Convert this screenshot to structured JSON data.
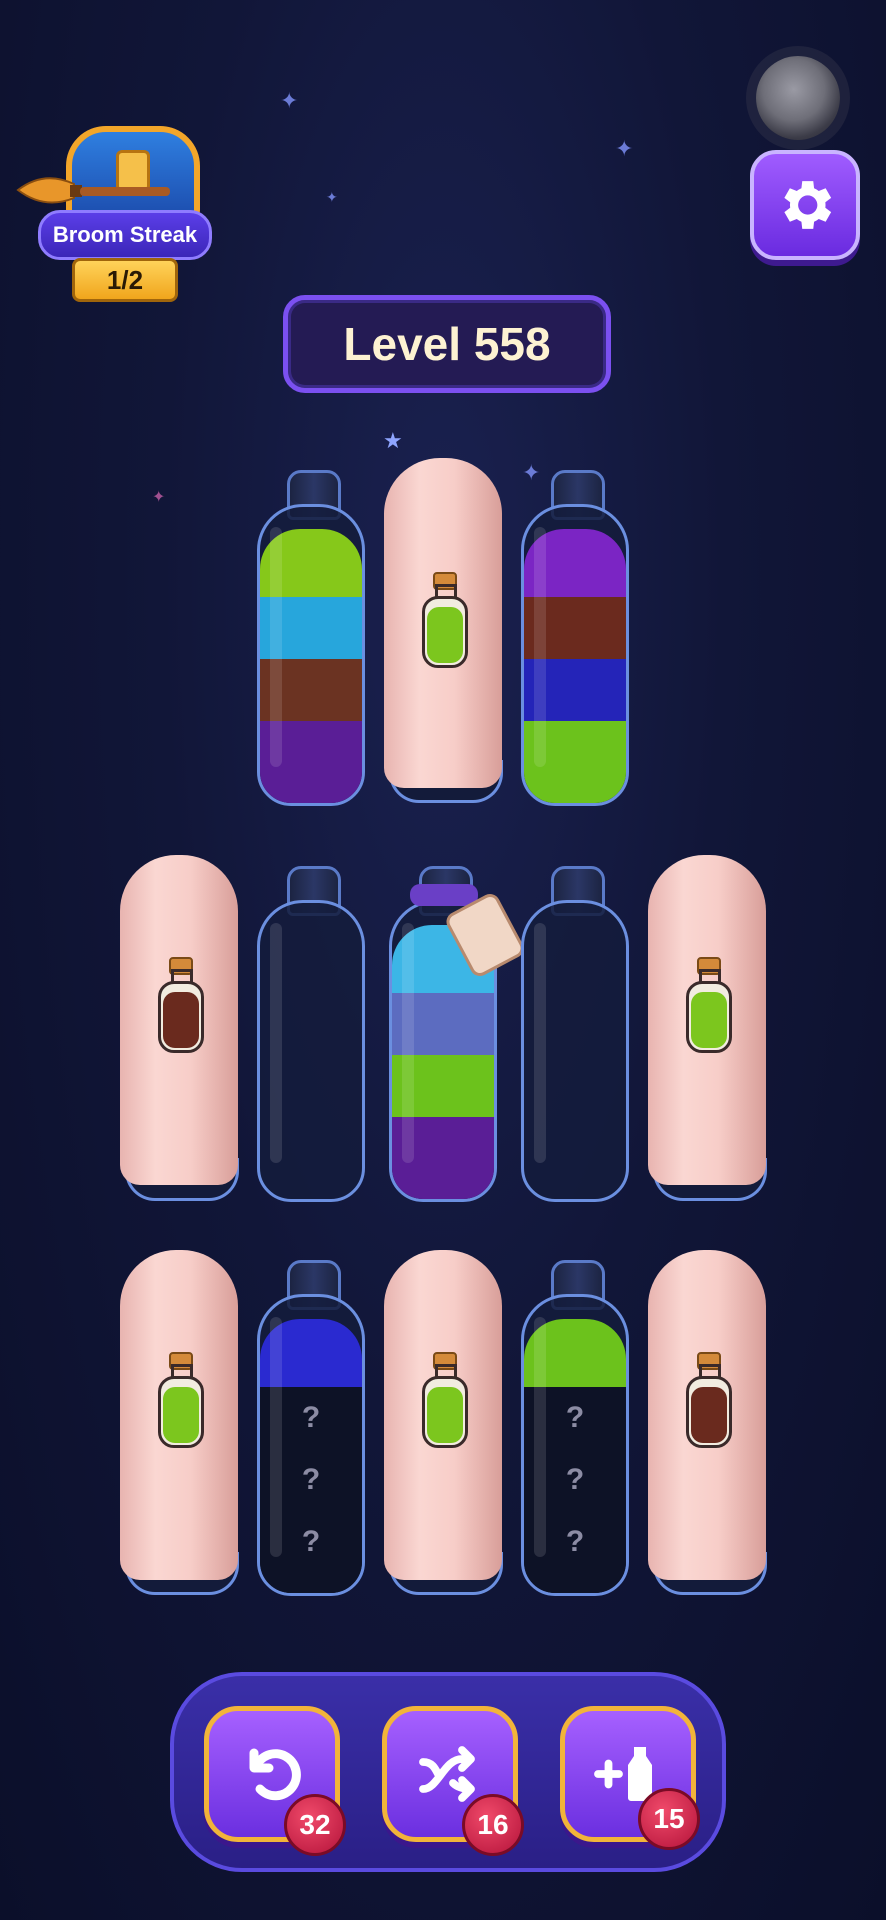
{
  "streak": {
    "label": "Broom Streak",
    "count": "1/2"
  },
  "level": {
    "label": "Level 558"
  },
  "icons": {
    "settings": "gear-icon",
    "record": "record-icon"
  },
  "bottles": {
    "row1": [
      {
        "type": "open",
        "layers": [
          "#86c81a",
          "#27a6dc",
          "#6b3322",
          "#5a1e96"
        ]
      },
      {
        "type": "covered",
        "potion_color": "#7cc61e"
      },
      {
        "type": "open",
        "layers": [
          "#7b25c4",
          "#6b2a1e",
          "#2424b8",
          "#6cc21c"
        ]
      }
    ],
    "row2": [
      {
        "type": "covered",
        "potion_color": "#6a2a1e"
      },
      {
        "type": "open",
        "layers": []
      },
      {
        "type": "tied",
        "layers": [
          "#3cb6e6",
          "#5c6cc0",
          "#6cc21c",
          "#5a1e96"
        ]
      },
      {
        "type": "open",
        "layers": []
      },
      {
        "type": "covered",
        "potion_color": "#7cc61e"
      }
    ],
    "row3": [
      {
        "type": "covered",
        "potion_color": "#7cc61e"
      },
      {
        "type": "hidden",
        "layers": [
          "#2a2ad0"
        ],
        "hidden_marks": [
          "?",
          "?",
          "?"
        ]
      },
      {
        "type": "covered",
        "potion_color": "#7cc61e"
      },
      {
        "type": "hidden",
        "layers": [
          "#6cc21c"
        ],
        "hidden_marks": [
          "?",
          "?",
          "?"
        ]
      },
      {
        "type": "covered",
        "potion_color": "#6a2a1e"
      }
    ]
  },
  "toolbar": {
    "undo": {
      "icon": "undo-icon",
      "count": "32"
    },
    "shuffle": {
      "icon": "shuffle-icon",
      "count": "16"
    },
    "add_bottle": {
      "icon": "add-bottle-icon",
      "count": "15"
    }
  }
}
